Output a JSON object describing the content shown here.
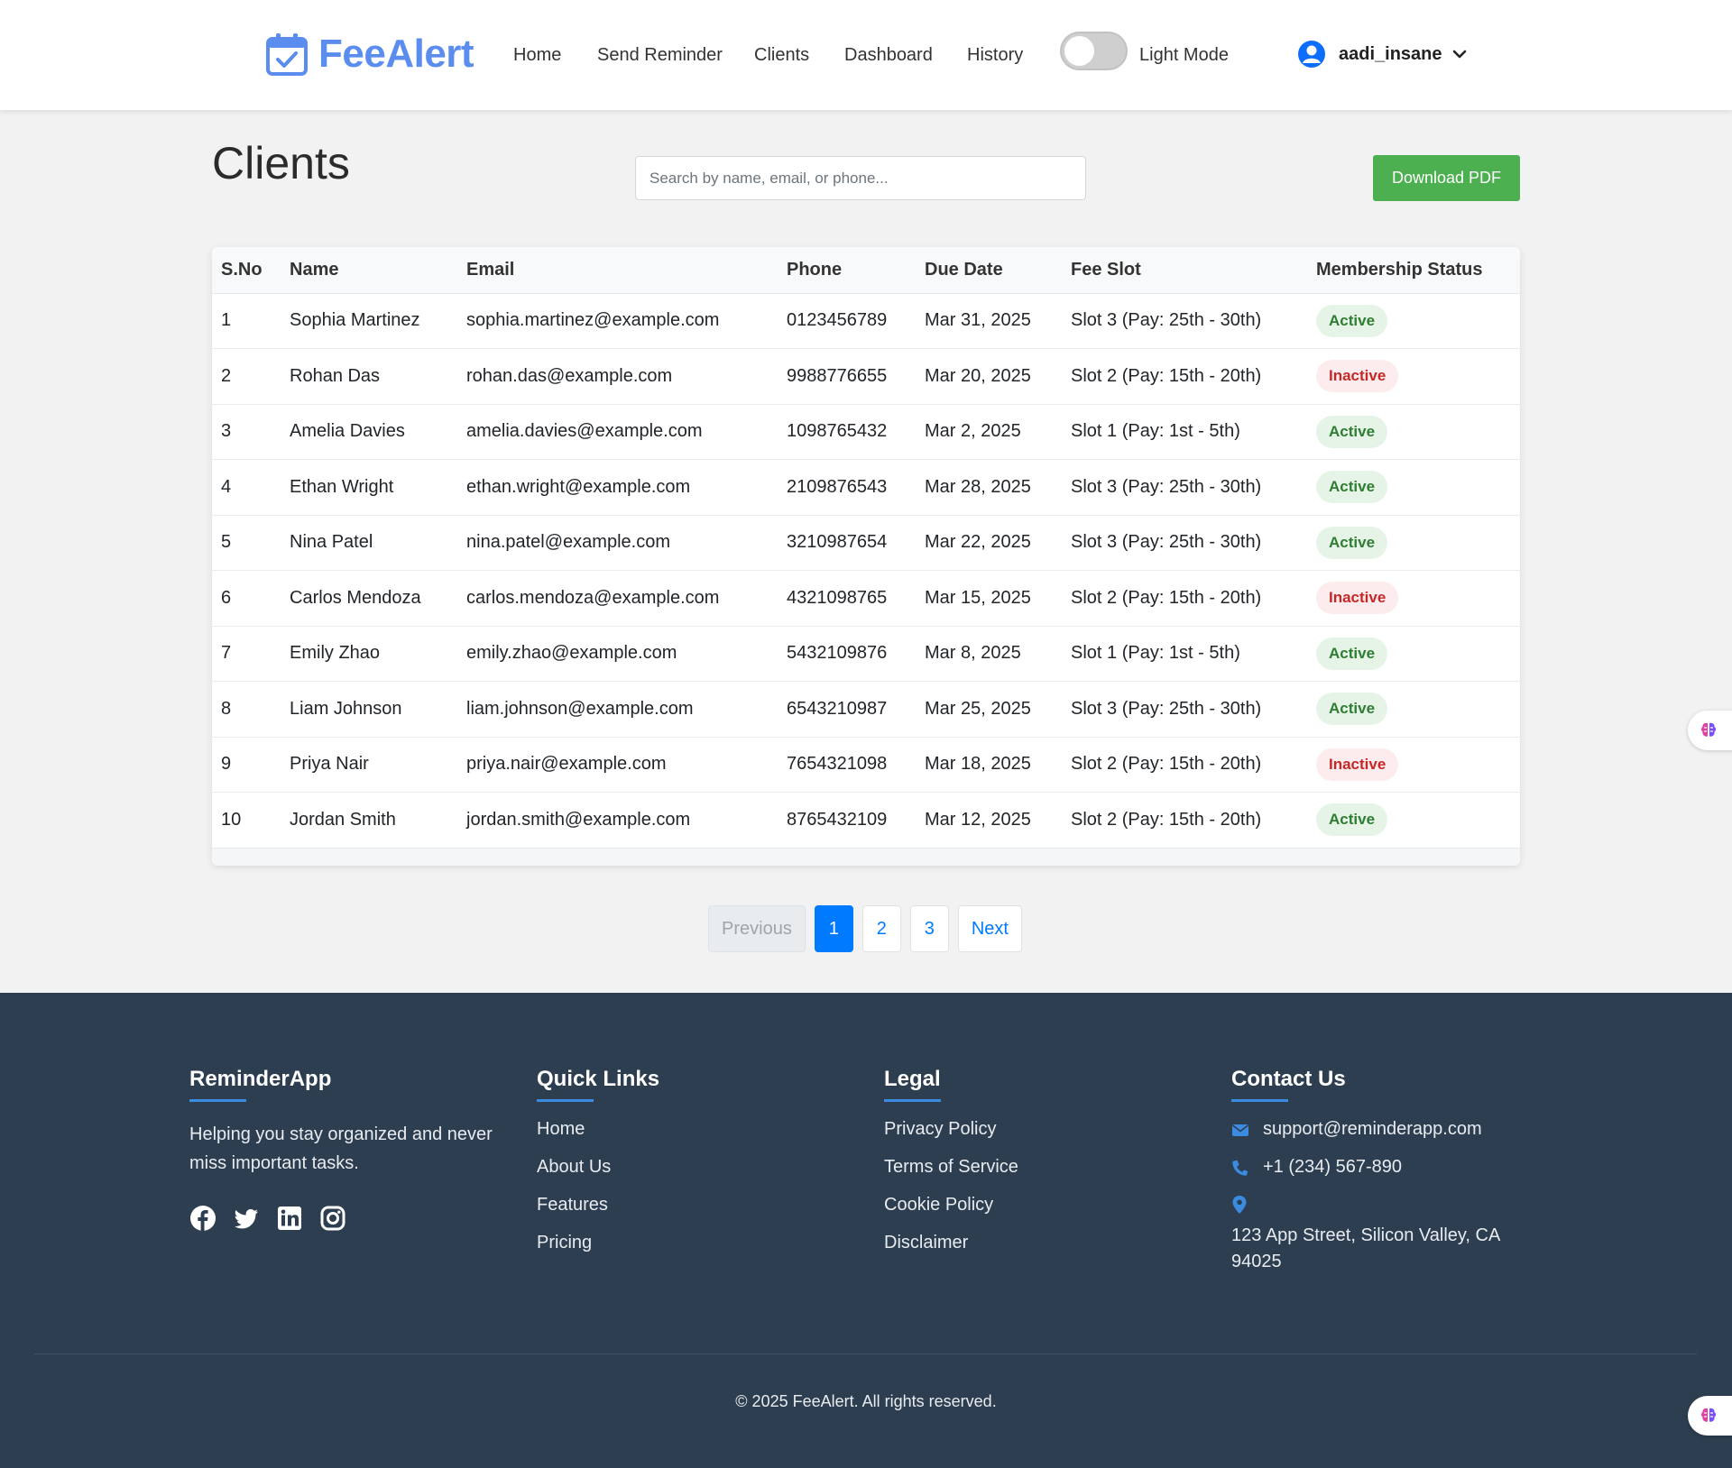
{
  "nav": {
    "brand": "FeeAlert",
    "links": [
      "Home",
      "Send Reminder",
      "Clients",
      "Dashboard",
      "History"
    ],
    "theme_toggle_label": "Light Mode",
    "username": "aadi_insane"
  },
  "page": {
    "title": "Clients",
    "search_placeholder": "Search by name, email, or phone...",
    "download_button": "Download PDF"
  },
  "table": {
    "headers": [
      "S.No",
      "Name",
      "Email",
      "Phone",
      "Due Date",
      "Fee Slot",
      "Membership Status"
    ],
    "rows": [
      [
        "1",
        "Sophia Martinez",
        "sophia.martinez@example.com",
        "0123456789",
        "Mar 31, 2025",
        "Slot 3 (Pay: 25th - 30th)",
        "Active"
      ],
      [
        "2",
        "Rohan Das",
        "rohan.das@example.com",
        "9988776655",
        "Mar 20, 2025",
        "Slot 2 (Pay: 15th - 20th)",
        "Inactive"
      ],
      [
        "3",
        "Amelia Davies",
        "amelia.davies@example.com",
        "1098765432",
        "Mar 2, 2025",
        "Slot 1 (Pay: 1st - 5th)",
        "Active"
      ],
      [
        "4",
        "Ethan Wright",
        "ethan.wright@example.com",
        "2109876543",
        "Mar 28, 2025",
        "Slot 3 (Pay: 25th - 30th)",
        "Active"
      ],
      [
        "5",
        "Nina Patel",
        "nina.patel@example.com",
        "3210987654",
        "Mar 22, 2025",
        "Slot 3 (Pay: 25th - 30th)",
        "Active"
      ],
      [
        "6",
        "Carlos Mendoza",
        "carlos.mendoza@example.com",
        "4321098765",
        "Mar 15, 2025",
        "Slot 2 (Pay: 15th - 20th)",
        "Inactive"
      ],
      [
        "7",
        "Emily Zhao",
        "emily.zhao@example.com",
        "5432109876",
        "Mar 8, 2025",
        "Slot 1 (Pay: 1st - 5th)",
        "Active"
      ],
      [
        "8",
        "Liam Johnson",
        "liam.johnson@example.com",
        "6543210987",
        "Mar 25, 2025",
        "Slot 3 (Pay: 25th - 30th)",
        "Active"
      ],
      [
        "9",
        "Priya Nair",
        "priya.nair@example.com",
        "7654321098",
        "Mar 18, 2025",
        "Slot 2 (Pay: 15th - 20th)",
        "Inactive"
      ],
      [
        "10",
        "Jordan Smith",
        "jordan.smith@example.com",
        "8765432109",
        "Mar 12, 2025",
        "Slot 2 (Pay: 15th - 20th)",
        "Active"
      ]
    ]
  },
  "pagination": {
    "previous": "Previous",
    "pages": [
      "1",
      "2",
      "3"
    ],
    "current": "1",
    "next": "Next"
  },
  "footer": {
    "about": {
      "heading": "ReminderApp",
      "text": "Helping you stay organized and never miss important tasks.",
      "socials": [
        "facebook-icon",
        "twitter-icon",
        "linkedin-icon",
        "instagram-icon"
      ]
    },
    "quick_links": {
      "heading": "Quick Links",
      "items": [
        "Home",
        "About Us",
        "Features",
        "Pricing"
      ]
    },
    "legal": {
      "heading": "Legal",
      "items": [
        "Privacy Policy",
        "Terms of Service",
        "Cookie Policy",
        "Disclaimer"
      ]
    },
    "contact": {
      "heading": "Contact Us",
      "email": "support@reminderapp.com",
      "phone": "+1 (234) 567-890",
      "address": "123 App Street, Silicon Valley, CA 94025"
    },
    "copyright": "© 2025 FeeAlert. All rights reserved."
  },
  "colors": {
    "brand": "#5b8dee",
    "download_button": "#4caf50",
    "pagination_active": "#007bff",
    "footer_bg": "#2d3e50",
    "active_badge_text": "#2e7d32",
    "inactive_badge_text": "#c62828"
  }
}
